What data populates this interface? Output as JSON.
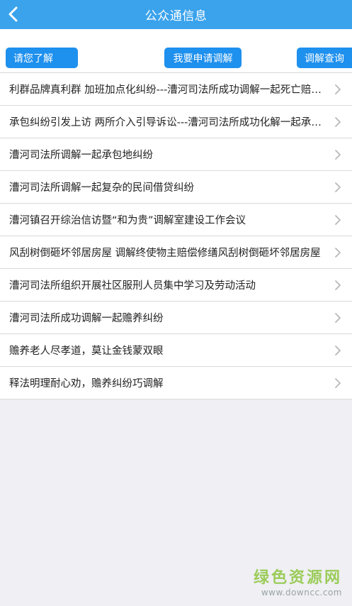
{
  "header": {
    "title": "公众通信息",
    "back_icon": "chevron-left-icon"
  },
  "tabs": {
    "left": "请您了解",
    "center": "我要申请调解",
    "right": "调解查询"
  },
  "colors": {
    "header_bg": "#3ba3ec",
    "button_bg": "#1e90ee",
    "page_bg": "#efeff4"
  },
  "items": [
    {
      "title": "利群品牌真利群 加班加点化纠纷---漕河司法所成功调解一起死亡赔偿纠纷"
    },
    {
      "title": "承包纠纷引发上访 两所介入引导诉讼---漕河司法所成功化解一起承包纠纷"
    },
    {
      "title": "漕河司法所调解一起承包地纠纷"
    },
    {
      "title": "漕河司法所调解一起复杂的民间借贷纠纷"
    },
    {
      "title": "漕河镇召开综治信访暨“和为贵”调解室建设工作会议"
    },
    {
      "title": "风刮树倒砸坏邻居房屋 调解终使物主赔偿修缮风刮树倒砸坏邻居房屋"
    },
    {
      "title": "漕河司法所组织开展社区服刑人员集中学习及劳动活动"
    },
    {
      "title": "漕河司法所成功调解一起赡养纠纷"
    },
    {
      "title": "赡养老人尽孝道，莫让金钱蒙双眼"
    },
    {
      "title": "释法明理耐心劝，赡养纠纷巧调解"
    }
  ],
  "watermark": {
    "name": "绿色资源网",
    "url": "www.downcc.com"
  }
}
